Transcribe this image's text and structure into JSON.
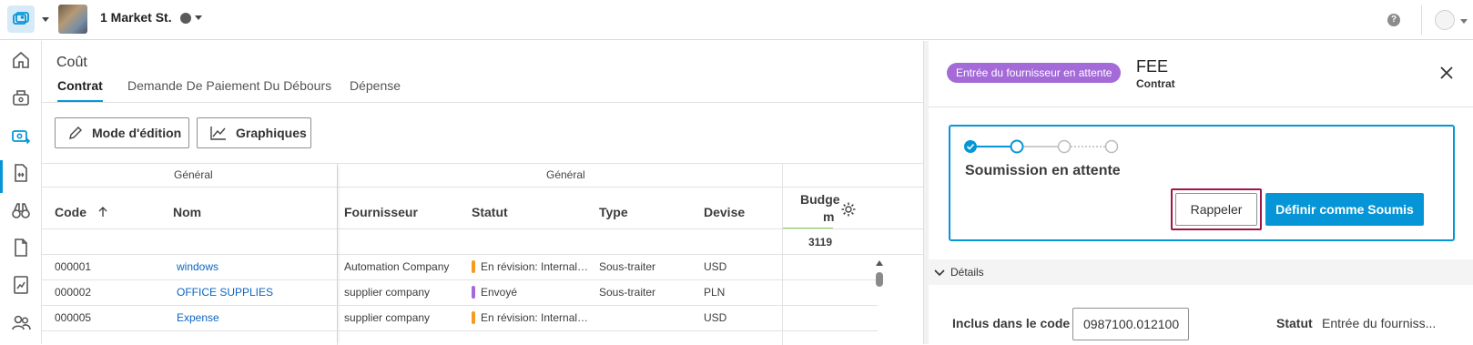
{
  "topbar": {
    "project_name": "1 Market St.",
    "help_label": "?"
  },
  "cost": {
    "breadcrumb": "Coût",
    "tabs": [
      "Contrat",
      "Demande De Paiement Du Débours",
      "Dépense"
    ],
    "toolbar": {
      "edit_mode": "Mode d'édition",
      "charts": "Graphiques"
    },
    "grid": {
      "group_headers": [
        "Général",
        "Général"
      ],
      "columns": [
        "Code",
        "Nom",
        "Fournisseur",
        "Statut",
        "Type",
        "Devise"
      ],
      "budget_header_1": "Budge",
      "budget_header_2": "m",
      "budget_total": "3119",
      "rows": [
        {
          "code": "000001",
          "name": "windows",
          "supplier": "Automation Company",
          "status": "En révision: Internal…",
          "status_color": "#f59b1f",
          "type": "Sous-traiter",
          "currency": "USD"
        },
        {
          "code": "000002",
          "name": "OFFICE SUPPLIES",
          "supplier": "supplier company",
          "status": "Envoyé",
          "status_color": "#a46ad8",
          "type": "Sous-traiter",
          "currency": "PLN"
        },
        {
          "code": "000005",
          "name": "Expense",
          "supplier": "supplier company",
          "status": "En révision: Internal…",
          "status_color": "#f59b1f",
          "type": "",
          "currency": "USD"
        }
      ]
    }
  },
  "panel": {
    "badge": "Entrée du fournisseur en attente",
    "title": "FEE",
    "subtitle": "Contrat",
    "step_status": "Soumission en attente",
    "recall_button": "Rappeler",
    "submit_button": "Définir comme Soumis",
    "details_label": "Détails",
    "included_in_code_label": "Inclus dans le code",
    "included_in_code_value": "0987100.012100",
    "status_label": "Statut",
    "status_value": "Entrée du fourniss..."
  },
  "colors": {
    "accent": "#0696d7",
    "badge": "#a46ad8",
    "highlight": "#a1164a"
  }
}
